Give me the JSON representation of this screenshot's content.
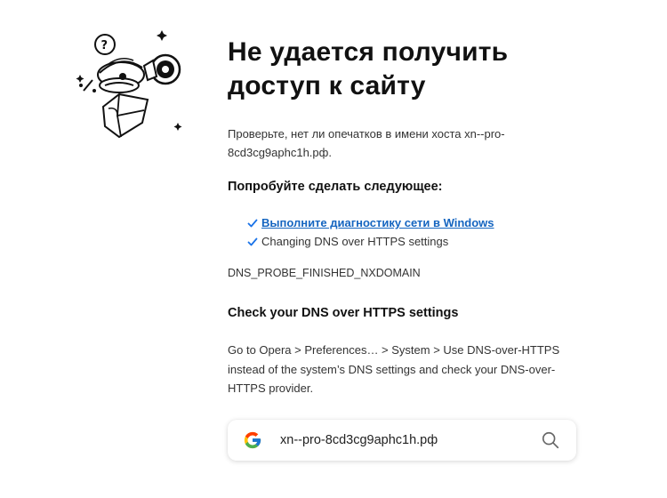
{
  "error_page": {
    "title": "Не удается получить доступ к сайту",
    "hint": "Проверьте, нет ли опечатков в имени хоста xn--pro-8cd3cg9aphc1h.рф.",
    "try_heading": "Попробуйте сделать следующее:",
    "suggestions": [
      {
        "label": "Выполните диагностику сети в Windows",
        "is_link": true
      },
      {
        "label": "Changing DNS over HTTPS settings",
        "is_link": false
      }
    ],
    "error_code": "DNS_PROBE_FINISHED_NXDOMAIN",
    "dns_heading": "Check your DNS over HTTPS settings",
    "dns_text": "Go to Opera > Preferences… > System > Use DNS-over-HTTPS instead of the system’s DNS settings and check your DNS-over-HTTPS provider."
  },
  "search": {
    "value": "xn--pro-8cd3cg9aphc1h.рф",
    "engine_icon": "google-icon",
    "action_icon": "search-icon"
  },
  "colors": {
    "link": "#1565c0",
    "check": "#1a73e8",
    "text": "#333333",
    "heading": "#111111"
  }
}
